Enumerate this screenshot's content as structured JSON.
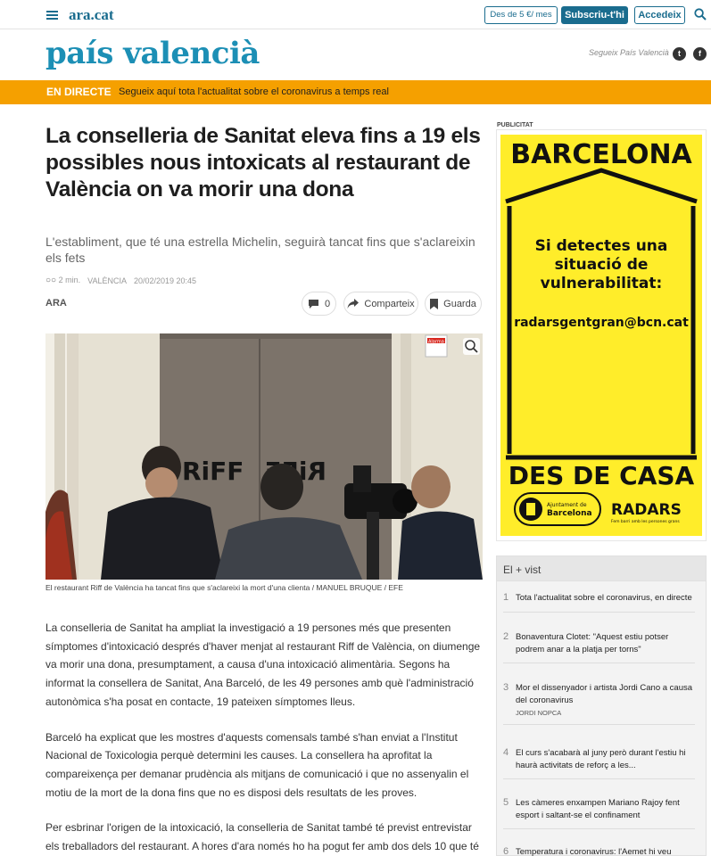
{
  "topbar": {
    "logo": "ara.cat",
    "price_button": "Des de 5 €/ mes",
    "subscribe_button": "Subscriu-t'hi",
    "login_button": "Accedeix"
  },
  "section": {
    "title": "país valencià",
    "follow_text": "Segueix País Valencià",
    "twitter_glyph": "t",
    "facebook_glyph": "f"
  },
  "live": {
    "tag": "EN DIRECTE",
    "text": "Segueix aquí tota l'actualitat sobre el coronavirus a temps real"
  },
  "article": {
    "headline": "La conselleria de Sanitat eleva fins a 19 els possibles nous intoxicats al restaurant de València on va morir una dona",
    "subtitle": "L'establiment, que té una estrella Michelin, seguirà tancat fins que s'aclareixin els fets",
    "reading_time": "2 min.",
    "location": "VALÈNCIA",
    "date": "20/02/2019 20:45",
    "author": "ARA",
    "comments_count": "0",
    "share_label": "Comparteix",
    "save_label": "Guarda",
    "photo_sign_left": "RiFF",
    "photo_sign_right": "RiFF",
    "photo_sticker": "Alarma",
    "caption": "El restaurant Riff de València ha tancat fins que s'aclareixi la mort d'una clienta / MANUEL BRUQUE / EFE",
    "paragraphs": [
      "La conselleria de Sanitat ha ampliat la investigació a 19 persones més que presenten símptomes d'intoxicació després d'haver menjat al restaurant Riff de València, on diumenge va morir una dona, presumptament, a causa d'una intoxicació alimentària. Segons ha informat la consellera de Sanitat, Ana Barceló, de les 49 persones amb què l'administració autonòmica s'ha posat en contacte, 19 pateixen símptomes lleus.",
      "Barceló ha explicat que les mostres d'aquests comensals també s'han enviat a l'Institut Nacional de Toxicologia perquè determini les causes. La consellera ha aprofitat la compareixença per demanar prudència als mitjans de comunicació i que no assenyalin el motiu de la mort de la dona fins que no es disposi dels resultats de les proves.",
      "Per esbrinar l'origen de la intoxicació, la conselleria de Sanitat també té previst entrevistar els treballadors del restaurant. A hores d'ara només ho ha pogut fer amb dos dels 10 que té"
    ]
  },
  "ad": {
    "label": "PUBLICITAT",
    "top_text": "BARCELONA",
    "message": "Si detectes una situació de vulnerabilitat:",
    "email": "radarsgentgran@bcn.cat",
    "bottom_text": "DES DE CASA",
    "sponsor_line1": "Ajuntament de",
    "sponsor_line2": "Barcelona",
    "brand": "RADARS",
    "brand_tagline": "Fem barri amb les persones grans"
  },
  "popular": {
    "title": "El + vist",
    "items": [
      {
        "num": "1",
        "text": "Tota l'actualitat sobre el coronavirus, en directe",
        "author": ""
      },
      {
        "num": "2",
        "text": "Bonaventura Clotet: \"Aquest estiu potser podrem anar a la platja per torns\"",
        "author": ""
      },
      {
        "num": "3",
        "text": "Mor el dissenyador i artista Jordi Cano a causa del coronavirus",
        "author": "JORDI NOPCA"
      },
      {
        "num": "4",
        "text": "El curs s'acabarà al juny però durant l'estiu hi haurà activitats de reforç a les...",
        "author": ""
      },
      {
        "num": "5",
        "text": "Les càmeres enxampen Mariano Rajoy fent esport i saltant-se el confinament",
        "author": ""
      },
      {
        "num": "6",
        "text": "Temperatura i coronavirus: l'Aemet hi veu relació",
        "author": ""
      }
    ]
  },
  "colors": {
    "brand_blue": "#1a6c8e",
    "section_blue": "#1c8fb5",
    "live_orange": "#f5a000",
    "ad_yellow": "#ffed2a"
  }
}
